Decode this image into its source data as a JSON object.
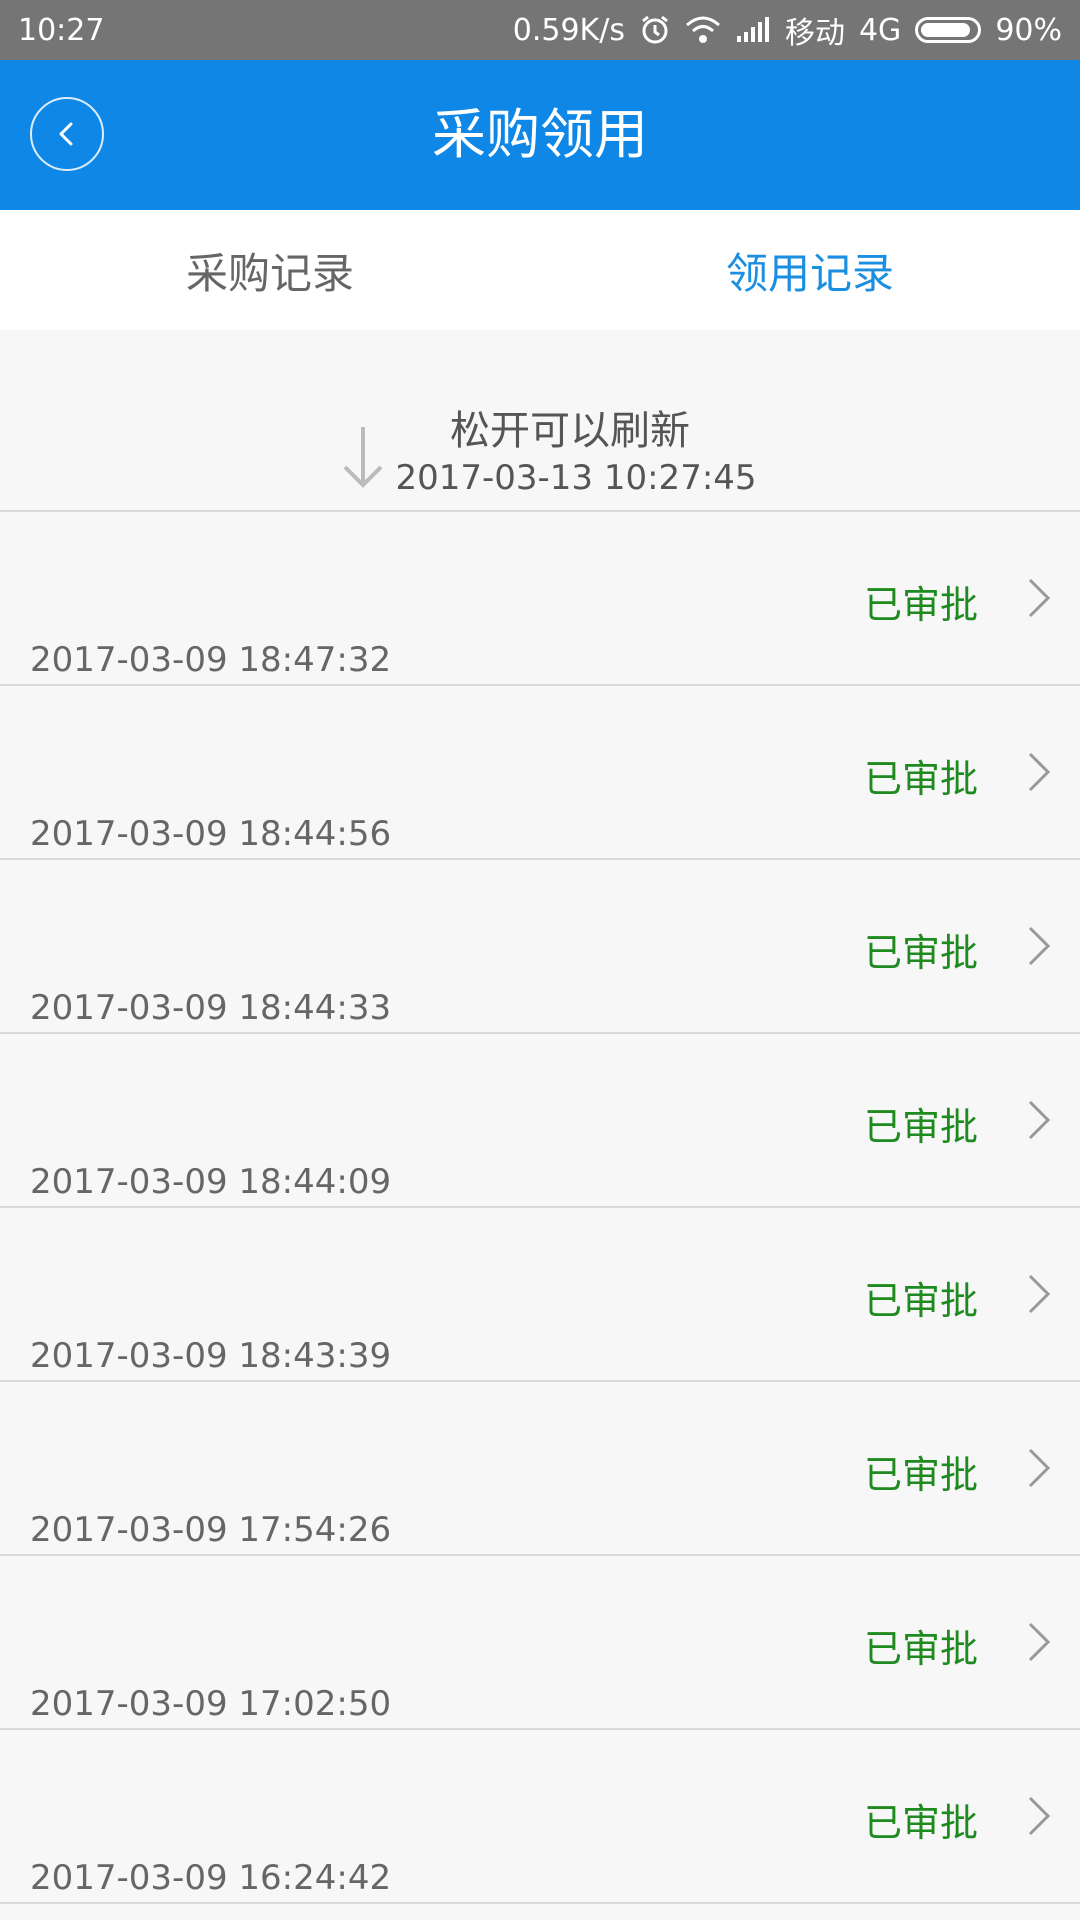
{
  "status_bar": {
    "time": "10:27",
    "speed": "0.59K/s",
    "carrier": "移动",
    "network": "4G",
    "battery": "90%",
    "battery_level": 0.9,
    "icons": [
      "alarm-icon",
      "wifi-icon",
      "signal-icon",
      "battery-icon"
    ]
  },
  "app_bar": {
    "title": "采购领用",
    "back_icon": "chevron-left-icon",
    "color": "#0f87e6"
  },
  "tabs": [
    {
      "label": "采购记录",
      "active": false
    },
    {
      "label": "领用记录",
      "active": true
    }
  ],
  "refresh": {
    "text": "松开可以刷新",
    "timestamp": "2017-03-13  10:27:45",
    "icon": "arrow-down-icon"
  },
  "records": [
    {
      "status": "已审批",
      "time": "2017-03-09 18:47:32"
    },
    {
      "status": "已审批",
      "time": "2017-03-09 18:44:56"
    },
    {
      "status": "已审批",
      "time": "2017-03-09 18:44:33"
    },
    {
      "status": "已审批",
      "time": "2017-03-09 18:44:09"
    },
    {
      "status": "已审批",
      "time": "2017-03-09 18:43:39"
    },
    {
      "status": "已审批",
      "time": "2017-03-09 17:54:26"
    },
    {
      "status": "已审批",
      "time": "2017-03-09 17:02:50"
    },
    {
      "status": "已审批",
      "time": "2017-03-09 16:24:42"
    }
  ],
  "colors": {
    "accent": "#1a8ee0",
    "approved": "#1f8a1f",
    "status_bar": "#757575"
  }
}
